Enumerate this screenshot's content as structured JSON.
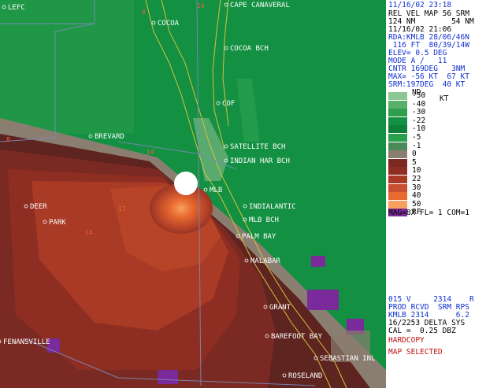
{
  "header": {
    "datetime": "11/16/02 23:18",
    "product_line": "REL VEL MAP 56 SRM",
    "range_line": "124 NM        54 NM",
    "vol_time": "11/16/02 21:06",
    "rda_line": "RDA:KMLB 28/06/46N",
    "elev_line": " 116 FT  80/39/14W",
    "elev_angle": "ELEV= 0.5 DEG",
    "mode": "MODE A /   11",
    "cntr": "CNTR 169DEG   3NM",
    "max": "MAX= -56 KT  67 KT",
    "srm": "SRM:197DEG  40 KT"
  },
  "legend": {
    "nd": "ND",
    "unit": "KT",
    "levels": [
      {
        "label": "-50",
        "color": "#8cc894"
      },
      {
        "label": "-40",
        "color": "#5ab06a"
      },
      {
        "label": "-30",
        "color": "#2e9e4c"
      },
      {
        "label": "-22",
        "color": "#139042"
      },
      {
        "label": "-10",
        "color": "#0f803a"
      },
      {
        "label": "-5",
        "color": "#2aa04e"
      },
      {
        "label": "-1",
        "color": "#4a8a58"
      },
      {
        "label": "0",
        "color": "#8a7e70"
      },
      {
        "label": "5",
        "color": "#7a2a22"
      },
      {
        "label": "10",
        "color": "#8e2e22"
      },
      {
        "label": "22",
        "color": "#a83a26"
      },
      {
        "label": "30",
        "color": "#c85030"
      },
      {
        "label": "40",
        "color": "#e86a30"
      },
      {
        "label": "50",
        "color": "#f8a060"
      },
      {
        "label": "RF",
        "color": "#7a2a9a"
      }
    ],
    "mag_line": "MAG=8X FL= 1 COM=1"
  },
  "footer": {
    "line1": "015 V     2314    R",
    "line2": "PROD RCVD  SRM RPS",
    "line3": "KMLB 2314      6.2",
    "line4": "16/2253 DELTA SYS",
    "line5": "CAL =  0.25 DBZ",
    "hardcopy": "HARDCOPY",
    "map_selected": "MAP SELECTED"
  },
  "map": {
    "towns": [
      {
        "name": "LEFC"
      },
      {
        "name": "COCOA"
      },
      {
        "name": "CAPE CANAVERAL"
      },
      {
        "name": "COCOA BCH"
      },
      {
        "name": "COF"
      },
      {
        "name": "BREVARD"
      },
      {
        "name": "SATELLITE BCH"
      },
      {
        "name": "INDIAN HAR BCH"
      },
      {
        "name": "MLB"
      },
      {
        "name": "INDIALANTIC"
      },
      {
        "name": "DEER"
      },
      {
        "name": "PARK"
      },
      {
        "name": "MLB BCH"
      },
      {
        "name": "PALM BAY"
      },
      {
        "name": "MALABAR"
      },
      {
        "name": "GRANT"
      },
      {
        "name": "BAREFOOT BAY"
      },
      {
        "name": "SEBASTIAN INL"
      },
      {
        "name": "ROSELAND"
      },
      {
        "name": "FENANSVILLE"
      }
    ],
    "county_numbers": [
      "8",
      "14",
      "8",
      "14",
      "14",
      "17"
    ]
  }
}
